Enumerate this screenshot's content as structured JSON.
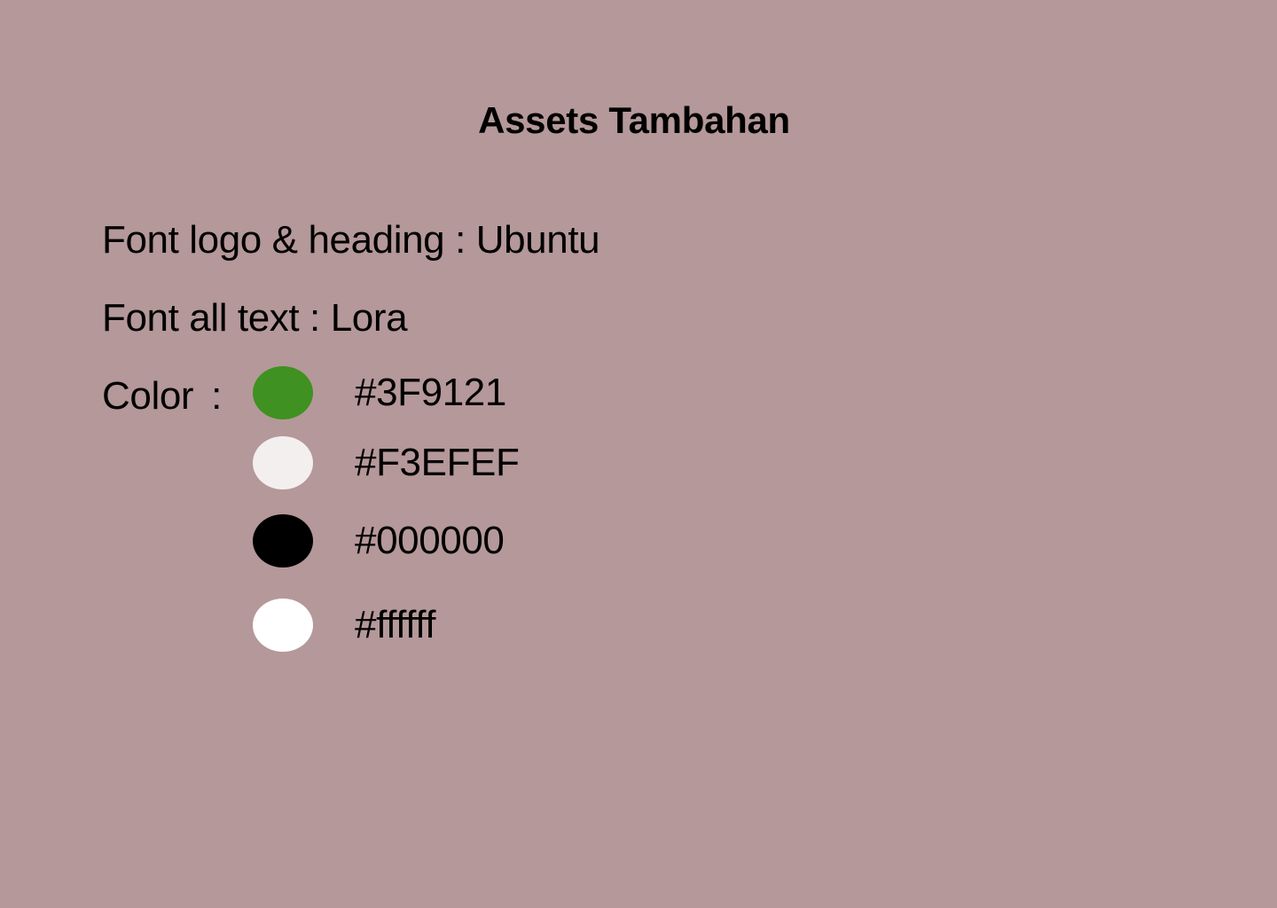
{
  "title": "Assets Tambahan",
  "fonts": {
    "heading_line": "Font logo & heading : Ubuntu",
    "text_line": "Font all text : Lora"
  },
  "color_section": {
    "label": "Color",
    "colon": ":"
  },
  "colors": [
    {
      "hex_label": "#3F9121",
      "swatch": "#3F9121"
    },
    {
      "hex_label": "#F3EFEF",
      "swatch": "#F3EFEF"
    },
    {
      "hex_label": "#000000",
      "swatch": "#000000"
    },
    {
      "hex_label": "#ffffff",
      "swatch": "#FFFFFF"
    }
  ],
  "theme": {
    "background": "#B59899",
    "text": "#000000"
  }
}
